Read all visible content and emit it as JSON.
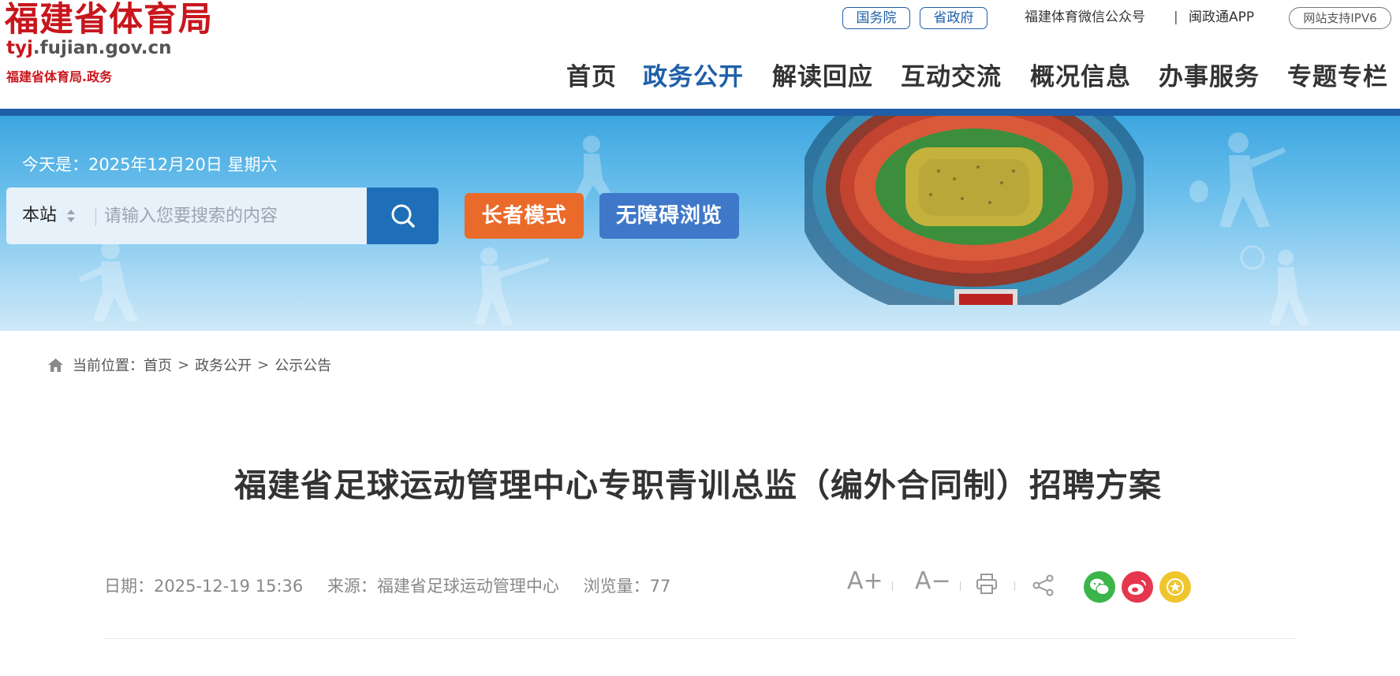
{
  "header": {
    "logo_title": "福建省体育局",
    "logo_domain_prefix": "tyj",
    "logo_domain_rest": ".fujian.gov.cn",
    "logo_sub": "福建省体育局.政务",
    "links": {
      "state_council": "国务院",
      "province_gov": "省政府",
      "wechat": "福建体育微信公众号",
      "separator": "|",
      "app": "闽政通APP",
      "ipv6": "网站支持IPV6"
    }
  },
  "nav": {
    "items": [
      "首页",
      "政务公开",
      "解读回应",
      "互动交流",
      "概况信息",
      "办事服务",
      "专题专栏"
    ],
    "active_index": 1
  },
  "banner": {
    "date_text": "今天是：2025年12月20日 星期六",
    "search": {
      "scope": "本站",
      "placeholder": "请输入您要搜索的内容"
    },
    "elder_mode": "长者模式",
    "accessible": "无障碍浏览"
  },
  "breadcrumb": {
    "label": "当前位置：",
    "items": [
      "首页",
      "政务公开",
      "公示公告"
    ],
    "separator": ">"
  },
  "article": {
    "title": "福建省足球运动管理中心专职青训总监（编外合同制）招聘方案",
    "date": "日期：2025-12-19 15:36",
    "source": "来源：福建省足球运动管理中心",
    "views": "浏览量：77"
  },
  "tools": {
    "font_up": "A+",
    "font_down": "A−",
    "icons": [
      "print-icon",
      "share-icon",
      "wechat-icon",
      "weibo-icon",
      "favorite-icon"
    ]
  },
  "colors": {
    "brand_red": "#c8161d",
    "brand_blue": "#1e5fa8",
    "elder_orange": "#ea6a2a",
    "access_blue": "#3f78c9",
    "wechat_green": "#3bb54a",
    "weibo_red": "#e5374e",
    "fav_yellow": "#efc52e"
  }
}
